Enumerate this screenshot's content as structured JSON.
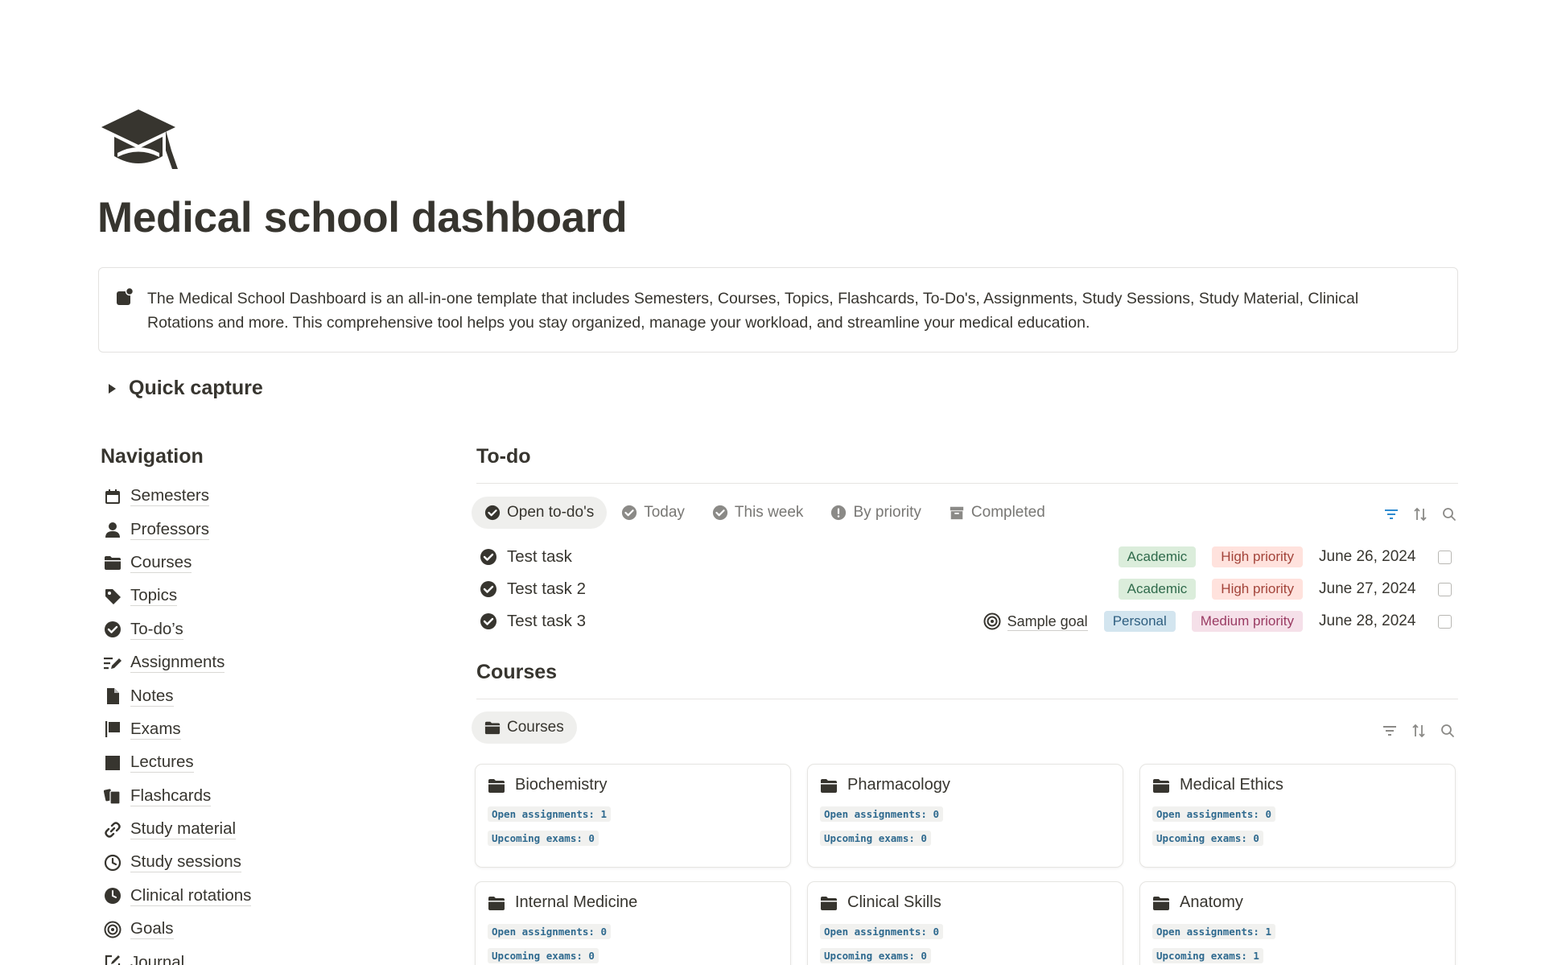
{
  "page": {
    "title": "Medical school dashboard",
    "icon": "graduation-cap-icon",
    "callout": {
      "icon": "bookmark-icon",
      "text": "The Medical School Dashboard is an all-in-one template that includes Semesters, Courses, Topics, Flashcards, To-Do's, Assignments, Study Sessions, Study Material, Clinical Rotations and more. This comprehensive tool helps you stay organized, manage your workload, and streamline your medical education."
    },
    "quick_capture": {
      "label": "Quick capture",
      "state": "collapsed"
    }
  },
  "navigation": {
    "heading": "Navigation",
    "items": [
      {
        "label": "Semesters",
        "icon": "calendar-icon"
      },
      {
        "label": "Professors",
        "icon": "person-icon"
      },
      {
        "label": "Courses",
        "icon": "folder-icon"
      },
      {
        "label": "Topics",
        "icon": "tag-icon"
      },
      {
        "label": "To-do’s",
        "icon": "check-circle-icon"
      },
      {
        "label": "Assignments",
        "icon": "edit-list-icon"
      },
      {
        "label": "Notes",
        "icon": "document-icon"
      },
      {
        "label": "Exams",
        "icon": "flag-icon"
      },
      {
        "label": "Lectures",
        "icon": "square-icon"
      },
      {
        "label": "Flashcards",
        "icon": "cards-icon"
      },
      {
        "label": "Study material",
        "icon": "link-icon"
      },
      {
        "label": "Study sessions",
        "icon": "clock-icon"
      },
      {
        "label": "Clinical rotations",
        "icon": "pie-clock-icon"
      },
      {
        "label": "Goals",
        "icon": "target-icon"
      },
      {
        "label": "Journal",
        "icon": "compose-icon"
      }
    ]
  },
  "todo": {
    "heading": "To-do",
    "tabs": [
      {
        "label": "Open to-do's",
        "icon": "check-circle-icon",
        "active": true
      },
      {
        "label": "Today",
        "icon": "check-circle-icon",
        "active": false
      },
      {
        "label": "This week",
        "icon": "check-circle-icon",
        "active": false
      },
      {
        "label": "By priority",
        "icon": "alert-circle-icon",
        "active": false
      },
      {
        "label": "Completed",
        "icon": "archive-icon",
        "active": false
      }
    ],
    "tools": [
      "filter-icon",
      "sort-icon",
      "search-icon"
    ],
    "rows": [
      {
        "title": "Test task",
        "goal": "",
        "category": "Academic",
        "priority": "High priority",
        "date": "June 26, 2024",
        "done": false
      },
      {
        "title": "Test task 2",
        "goal": "",
        "category": "Academic",
        "priority": "High priority",
        "date": "June 27, 2024",
        "done": false
      },
      {
        "title": "Test task 3",
        "goal": "Sample goal",
        "category": "Personal",
        "priority": "Medium priority",
        "date": "June 28, 2024",
        "done": false
      }
    ]
  },
  "courses": {
    "heading": "Courses",
    "tab": {
      "label": "Courses",
      "icon": "folder-icon"
    },
    "tools": [
      "filter-icon",
      "sort-icon",
      "search-icon"
    ],
    "cards": [
      {
        "title": "Biochemistry",
        "assignments": "Open assignments: 1",
        "exams": "Upcoming exams: 0"
      },
      {
        "title": "Pharmacology",
        "assignments": "Open assignments: 0",
        "exams": "Upcoming exams: 0"
      },
      {
        "title": "Medical Ethics",
        "assignments": "Open assignments: 0",
        "exams": "Upcoming exams: 0"
      },
      {
        "title": "Internal Medicine",
        "assignments": "Open assignments: 0",
        "exams": "Upcoming exams: 0"
      },
      {
        "title": "Clinical Skills",
        "assignments": "Open assignments: 0",
        "exams": "Upcoming exams: 0"
      },
      {
        "title": "Anatomy",
        "assignments": "Open assignments: 1",
        "exams": "Upcoming exams: 1"
      }
    ]
  }
}
